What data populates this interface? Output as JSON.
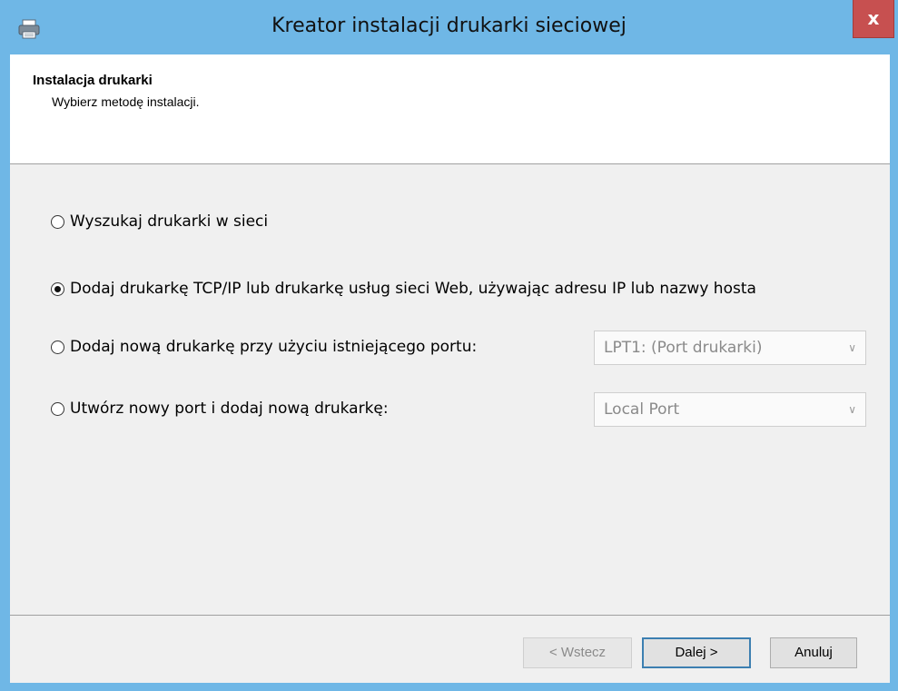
{
  "window": {
    "title": "Kreator instalacji drukarki sieciowej",
    "close_label": "x",
    "app_icon": "printer-icon"
  },
  "header": {
    "title": "Instalacja drukarki",
    "subtitle": "Wybierz metodę instalacji."
  },
  "options": [
    {
      "label": "Wyszukaj drukarki w sieci",
      "checked": false
    },
    {
      "label": "Dodaj drukarkę TCP/IP lub drukarkę usług sieci Web, używając adresu IP lub nazwy hosta",
      "checked": true
    },
    {
      "label": "Dodaj nową drukarkę przy użyciu istniejącego portu:",
      "checked": false
    },
    {
      "label": "Utwórz nowy port i dodaj nową drukarkę:",
      "checked": false
    }
  ],
  "selects": {
    "existing_port": {
      "value": "LPT1: (Port drukarki)",
      "disabled": true
    },
    "new_port_type": {
      "value": "Local Port",
      "disabled": true
    }
  },
  "buttons": {
    "back": "< Wstecz",
    "next": "Dalej >",
    "cancel": "Anuluj"
  },
  "colors": {
    "frame": "#6fb7e6",
    "close": "#c75050",
    "client_bg": "#f0f0f0"
  }
}
